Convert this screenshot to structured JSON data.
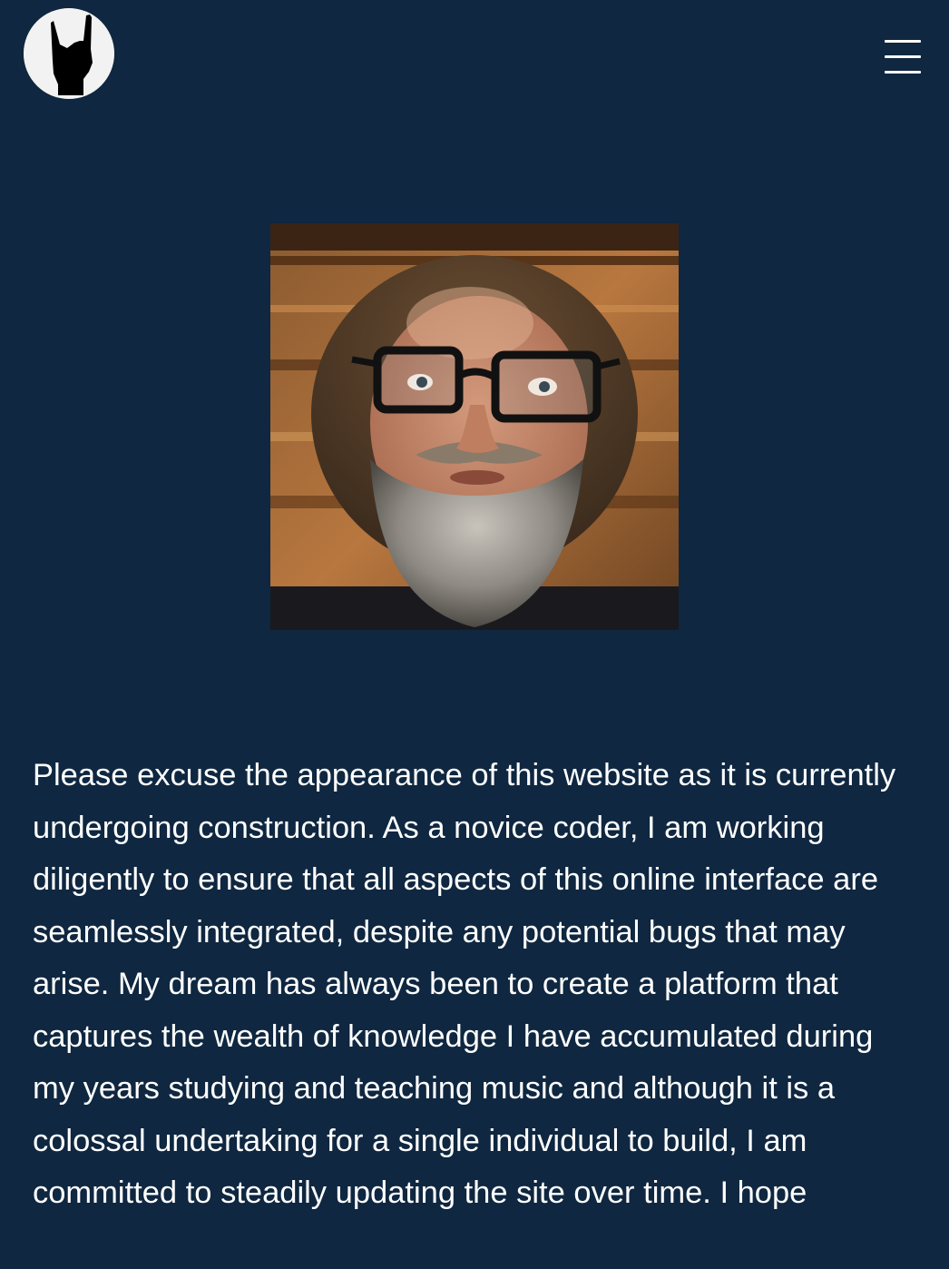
{
  "header": {
    "logo_icon": "rock-hand-icon",
    "menu_icon": "hamburger-menu-icon"
  },
  "profile": {
    "photo_alt": "Bearded man with glasses"
  },
  "intro": {
    "text": "Please excuse the appearance of this website as it is currently undergoing construction. As a novice coder, I am working diligently to ensure that all aspects of this online interface are seamlessly integrated, despite any potential bugs that may arise. My dream has always been to create a platform that captures the wealth of knowledge I have accumulated during my years studying and teaching music and although it is a colossal undertaking for a single individual to build, I am committed to steadily updating the site over time. I hope"
  },
  "colors": {
    "background": "#0f2740",
    "text": "#ffffff",
    "logo_bg": "#f2f2f2"
  }
}
